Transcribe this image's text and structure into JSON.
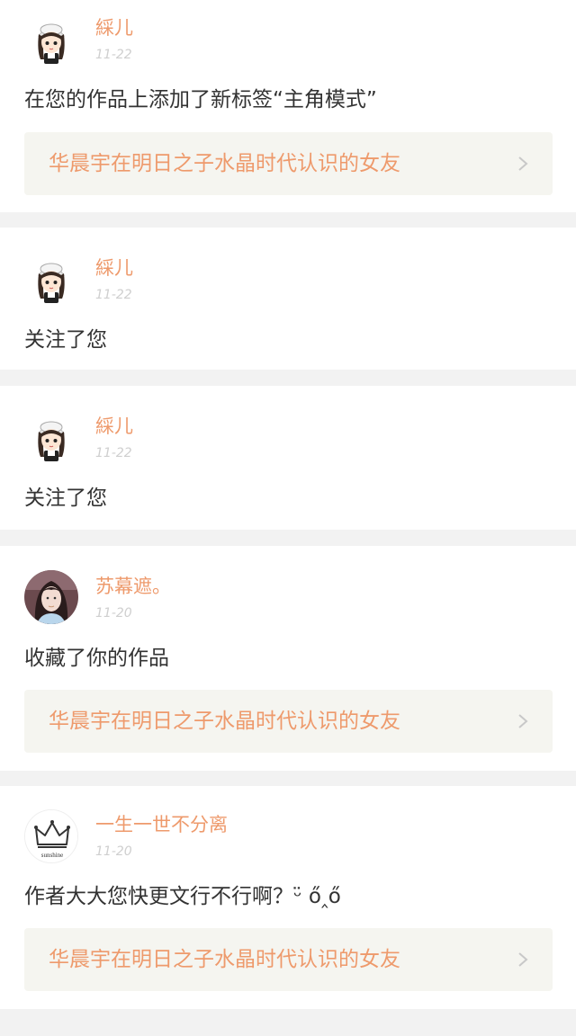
{
  "notifications": [
    {
      "user": "綵儿",
      "date": "11-22",
      "avatar": "girl-cartoon-avatar",
      "action": "在您的作品上添加了新标签“主角模式”",
      "work": "华晨宇在明日之子水晶时代认识的女友"
    },
    {
      "user": "綵儿",
      "date": "11-22",
      "avatar": "girl-cartoon-avatar",
      "action": "关注了您"
    },
    {
      "user": "綵儿",
      "date": "11-22",
      "avatar": "girl-cartoon-avatar",
      "action": "关注了您"
    },
    {
      "user": "苏幕遮。",
      "date": "11-20",
      "avatar": "user-photo-avatar",
      "action": "收藏了你的作品",
      "work": "华晨宇在明日之子水晶时代认识的女友"
    },
    {
      "user": "一生一世不分离",
      "date": "11-20",
      "avatar": "crown-sunshine-avatar",
      "avatar_text": "sunshine",
      "action": "作者大大您快更文行不行啊？ᵕ̈ ő‸ő",
      "work": "华晨宇在明日之子水晶时代认识的女友"
    }
  ],
  "icons": {
    "work_link": "chevron-right-icon"
  },
  "colors": {
    "accent": "#ee9a6c",
    "background": "#f2f2f2",
    "card": "#ffffff",
    "link_box": "#f5f5f0",
    "date": "#cfcfcf",
    "text": "#333333"
  }
}
